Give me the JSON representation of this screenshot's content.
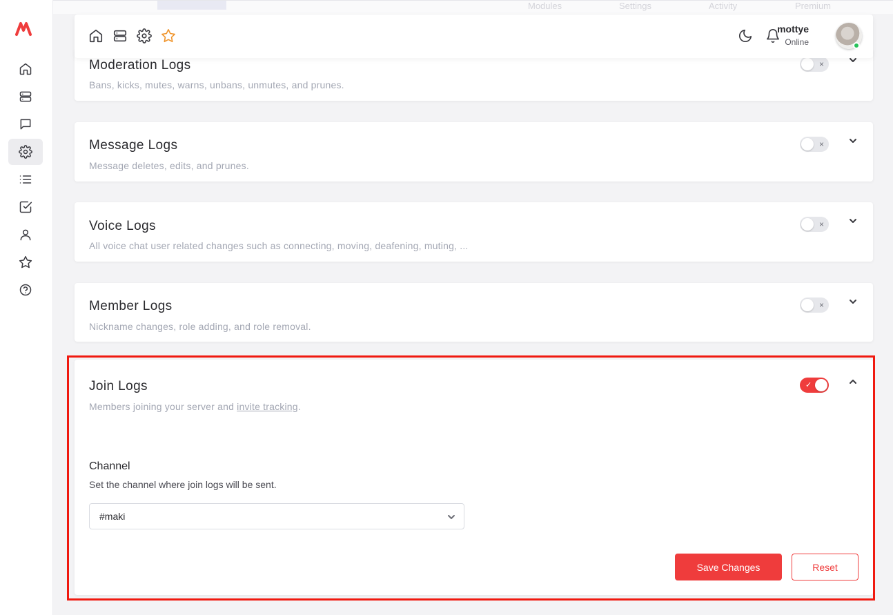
{
  "background_tabs": [
    "Modules",
    "Settings",
    "Activity",
    "Premium"
  ],
  "topbar": {
    "icons": [
      "home-icon",
      "server-icon",
      "gear-icon",
      "star-icon"
    ],
    "user": {
      "name": "mottye",
      "status": "Online"
    },
    "theme_icon": "moon-icon",
    "notification_icon": "bell-icon",
    "star_color": "#f0962f"
  },
  "sidebar": {
    "items": [
      "home-icon",
      "server-icon",
      "message-icon",
      "gear-icon",
      "list-icon",
      "checkbox-icon",
      "user-icon",
      "star-icon",
      "help-icon"
    ],
    "active": "gear-icon"
  },
  "cards": [
    {
      "title": "Moderation Logs",
      "description": "Bans, kicks, mutes, warns, unbans, unmutes, and prunes.",
      "enabled": false,
      "toggle_mark": "×"
    },
    {
      "title": "Message Logs",
      "description": "Message deletes, edits, and prunes.",
      "enabled": false,
      "toggle_mark": "×"
    },
    {
      "title": "Voice Logs",
      "description": "All voice chat user related changes such as connecting, moving, deafening, muting, ...",
      "enabled": false,
      "toggle_mark": "×"
    },
    {
      "title": "Member Logs",
      "description": "Nickname changes, role adding, and role removal.",
      "enabled": false,
      "toggle_mark": "×"
    },
    {
      "title": "Join Logs",
      "description_prefix": "Members joining your server and ",
      "description_link": "invite tracking",
      "description_suffix": ".",
      "enabled": true,
      "toggle_mark": "✓",
      "channel": {
        "label": "Channel",
        "help": "Set the channel where join logs will be sent.",
        "value": "#maki"
      },
      "save_label": "Save Changes",
      "reset_label": "Reset"
    }
  ],
  "colors": {
    "accent": "#ef3c3c",
    "highlight_border": "#f0190f",
    "online": "#27c25a"
  }
}
